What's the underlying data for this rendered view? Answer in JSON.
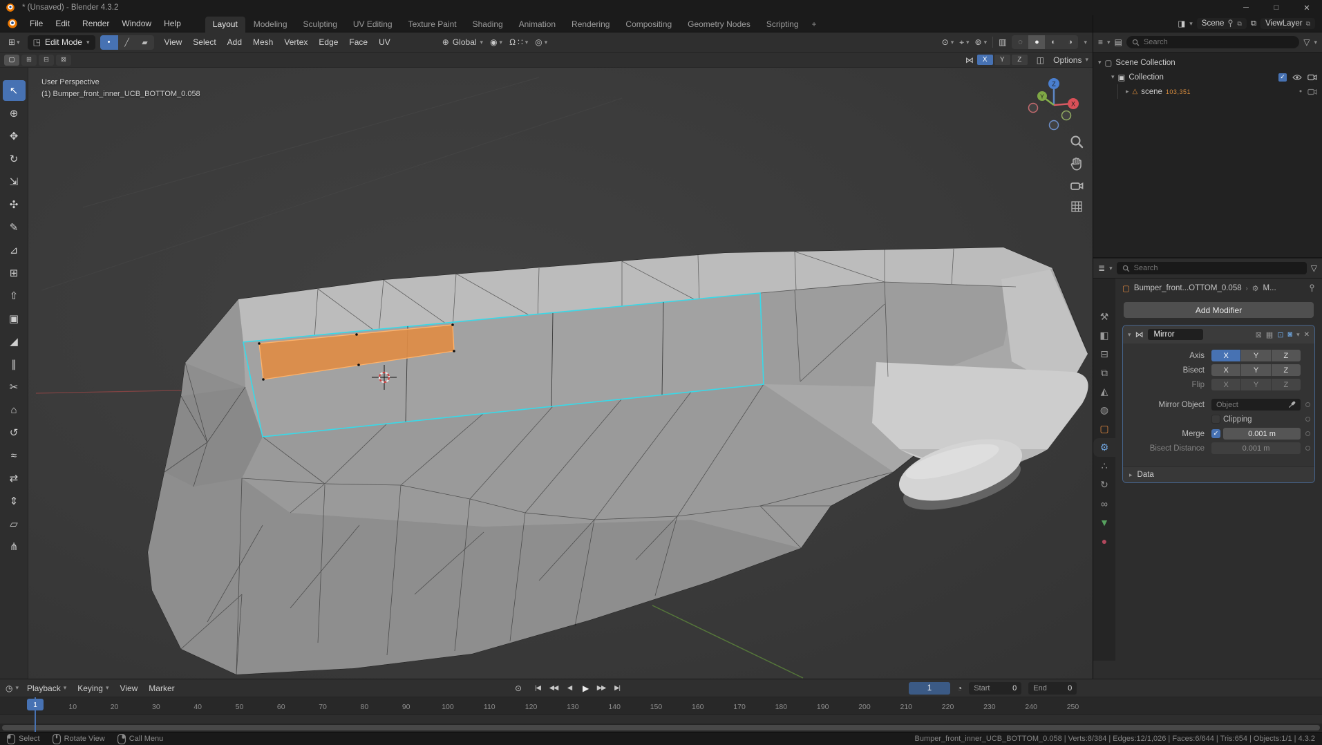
{
  "window": {
    "title": "* (Unsaved) - Blender 4.3.2",
    "minimize": "─",
    "maximize": "□",
    "close": "✕"
  },
  "topbar": {
    "menus": [
      "File",
      "Edit",
      "Render",
      "Window",
      "Help"
    ],
    "workspaces": [
      "Layout",
      "Modeling",
      "Sculpting",
      "UV Editing",
      "Texture Paint",
      "Shading",
      "Animation",
      "Rendering",
      "Compositing",
      "Geometry Nodes",
      "Scripting"
    ],
    "active_workspace": "Layout",
    "add_tab": "+",
    "scene": {
      "label": "Scene"
    },
    "viewlayer": {
      "label": "ViewLayer"
    }
  },
  "header": {
    "mode": "Edit Mode",
    "menus": [
      "View",
      "Select",
      "Add",
      "Mesh",
      "Vertex",
      "Edge",
      "Face",
      "UV"
    ],
    "orientation": "Global"
  },
  "tool_settings": {
    "select_options": [
      {
        "name": "set",
        "glyph": "▢",
        "active": true
      },
      {
        "name": "extend",
        "glyph": "⊞",
        "active": false
      },
      {
        "name": "subtract",
        "glyph": "⊟",
        "active": false
      },
      {
        "name": "intersect",
        "glyph": "⊠",
        "active": false
      }
    ],
    "axes": [
      "X",
      "Y",
      "Z"
    ],
    "active_axis": "X",
    "options_label": "Options"
  },
  "viewport": {
    "overlay_line1": "User Perspective",
    "overlay_line2": "(1) Bumper_front_inner_UCB_BOTTOM_0.058",
    "gizmo": {
      "x": "X",
      "y": "Y",
      "z": "Z"
    }
  },
  "toolbar": {
    "tools": [
      {
        "name": "select-box",
        "glyph": "↖",
        "active": true
      },
      {
        "name": "cursor",
        "glyph": "⊕",
        "active": false
      },
      {
        "name": "move",
        "glyph": "✥",
        "active": false
      },
      {
        "name": "rotate",
        "glyph": "↻",
        "active": false
      },
      {
        "name": "scale",
        "glyph": "⇲",
        "active": false
      },
      {
        "name": "transform",
        "glyph": "✣",
        "active": false
      },
      {
        "name": "annotate",
        "glyph": "✎",
        "active": false
      },
      {
        "name": "measure",
        "glyph": "⊿",
        "active": false
      },
      {
        "name": "add-cube",
        "glyph": "⊞",
        "active": false
      },
      {
        "name": "extrude-region",
        "glyph": "⇧",
        "active": false
      },
      {
        "name": "inset-faces",
        "glyph": "▣",
        "active": false
      },
      {
        "name": "bevel",
        "glyph": "◢",
        "active": false
      },
      {
        "name": "loop-cut",
        "glyph": "∥",
        "active": false
      },
      {
        "name": "knife",
        "glyph": "✂",
        "active": false
      },
      {
        "name": "poly-build",
        "glyph": "⌂",
        "active": false
      },
      {
        "name": "spin",
        "glyph": "↺",
        "active": false
      },
      {
        "name": "smooth",
        "glyph": "≈",
        "active": false
      },
      {
        "name": "edge-slide",
        "glyph": "⇄",
        "active": false
      },
      {
        "name": "shrink-fatten",
        "glyph": "⇕",
        "active": false
      },
      {
        "name": "shear",
        "glyph": "▱",
        "active": false
      },
      {
        "name": "rip-region",
        "glyph": "⋔",
        "active": false
      }
    ]
  },
  "outliner": {
    "search_placeholder": "Search",
    "scene_collection": "Scene Collection",
    "collection": "Collection",
    "object_name": "scene",
    "object_badge": "103,351"
  },
  "properties": {
    "search_placeholder": "Search",
    "breadcrumb_object": "Bumper_front...OTTOM_0.058",
    "breadcrumb_sub": "M...",
    "add_modifier": "Add Modifier",
    "tabs": [
      {
        "name": "tool",
        "glyph": "⚒",
        "color": "#9a9a9a",
        "active": false
      },
      {
        "name": "render",
        "glyph": "◧",
        "color": "#9a9a9a",
        "active": false
      },
      {
        "name": "output",
        "glyph": "⊟",
        "color": "#9a9a9a",
        "active": false
      },
      {
        "name": "view-layer",
        "glyph": "⧉",
        "color": "#9a9a9a",
        "active": false
      },
      {
        "name": "scene",
        "glyph": "◭",
        "color": "#9a9a9a",
        "active": false
      },
      {
        "name": "world",
        "glyph": "◍",
        "color": "#9a9a9a",
        "active": false
      },
      {
        "name": "object",
        "glyph": "▢",
        "color": "#e0883f",
        "active": false
      },
      {
        "name": "modifiers",
        "glyph": "⚙",
        "color": "#71a8e3",
        "active": true
      },
      {
        "name": "particles",
        "glyph": "∴",
        "color": "#9a9a9a",
        "active": false
      },
      {
        "name": "physics",
        "glyph": "↻",
        "color": "#9a9a9a",
        "active": false
      },
      {
        "name": "constraints",
        "glyph": "∞",
        "color": "#9a9a9a",
        "active": false
      },
      {
        "name": "object-data",
        "glyph": "▼",
        "color": "#57a25f",
        "active": false
      },
      {
        "name": "material",
        "glyph": "●",
        "color": "#b3485d",
        "active": false
      }
    ],
    "modifier": {
      "name": "Mirror",
      "header_icons": [
        {
          "name": "show-on-cage-icon",
          "glyph": "⊠",
          "on": false
        },
        {
          "name": "show-in-editmode-icon",
          "glyph": "▦",
          "on": false
        },
        {
          "name": "show-viewport-icon",
          "glyph": "⊡",
          "on": true
        },
        {
          "name": "show-render-icon",
          "glyph": "◙",
          "on": true
        }
      ],
      "axis_label": "Axis",
      "bisect_label": "Bisect",
      "flip_label": "Flip",
      "axes": [
        "X",
        "Y",
        "Z"
      ],
      "active_axis": "X",
      "mirror_object_label": "Mirror Object",
      "mirror_object_placeholder": "Object",
      "clipping_label": "Clipping",
      "merge_label": "Merge",
      "merge_value": "0.001 m",
      "bisect_distance_label": "Bisect Distance",
      "bisect_distance_value": "0.001 m",
      "data_label": "Data"
    }
  },
  "timeline": {
    "menus": [
      {
        "label": "Playback",
        "dropdown": true
      },
      {
        "label": "Keying",
        "dropdown": true
      },
      {
        "label": "View",
        "dropdown": false
      },
      {
        "label": "Marker",
        "dropdown": false
      }
    ],
    "playback": [
      {
        "name": "jump-to-start",
        "glyph": "|◀"
      },
      {
        "name": "previous-keyframe",
        "glyph": "◀◀"
      },
      {
        "name": "play-reverse",
        "glyph": "◀"
      },
      {
        "name": "play",
        "glyph": "▶"
      },
      {
        "name": "next-keyframe",
        "glyph": "▶▶"
      },
      {
        "name": "jump-to-end",
        "glyph": "▶|"
      }
    ],
    "current_frame": "1",
    "playhead_frame": "1",
    "start_label": "Start",
    "start_value": "0",
    "end_label": "End",
    "end_value": "0",
    "ticks": [
      "10",
      "20",
      "30",
      "40",
      "50",
      "60",
      "70",
      "80",
      "90",
      "100",
      "110",
      "120",
      "130",
      "140",
      "150",
      "160",
      "170",
      "180",
      "190",
      "200",
      "210",
      "220",
      "230",
      "240",
      "250"
    ]
  },
  "statusbar": {
    "hints": [
      {
        "button": "left",
        "label": "Select"
      },
      {
        "button": "middle",
        "label": "Rotate View"
      },
      {
        "button": "right",
        "label": "Call Menu"
      }
    ],
    "stats": "Bumper_front_inner_UCB_BOTTOM_0.058 | Verts:8/384 | Edges:12/1,026 | Faces:6/644 | Tris:654 | Objects:1/1 | 4.3.2"
  },
  "icons": {
    "dropdown": "▾",
    "collapse": "▾",
    "expand": "▸",
    "breadcrumb_sep": "›",
    "editor_3d": "⊞",
    "editor_outliner": "≡",
    "editor_properties": "≣",
    "editor_timeline": "◷",
    "mode_cube": "◳",
    "select_vertex": "•",
    "select_edge": "╱",
    "select_face": "▰",
    "globe": "⊕",
    "pivot": "◉",
    "magnet": "Ω",
    "snap_with": "∷",
    "proportional": "◎",
    "visibility": "⊙",
    "gizmos": "⌖",
    "overlays": "⊚",
    "xray": "▥",
    "shade_wireframe": "◌",
    "shade_solid": "●",
    "shade_material": "◐",
    "shade_rendered": "◑",
    "outliner_display": "▤",
    "filter": "▽",
    "scene_collection": "▢",
    "collection": "▣",
    "mesh_object": "△",
    "scene_browse": "◨",
    "copy": "⧉",
    "viewlayer": "⧉",
    "mirror": "⋈",
    "tool_extra": "◫",
    "stopwatch": "◔",
    "autokey": "⊙",
    "check": "✓",
    "dot": "•",
    "close": "✕"
  },
  "colors": {
    "accent": "#4772b3",
    "face_select": "#de8c45",
    "edge_select": "#38d9e8"
  }
}
